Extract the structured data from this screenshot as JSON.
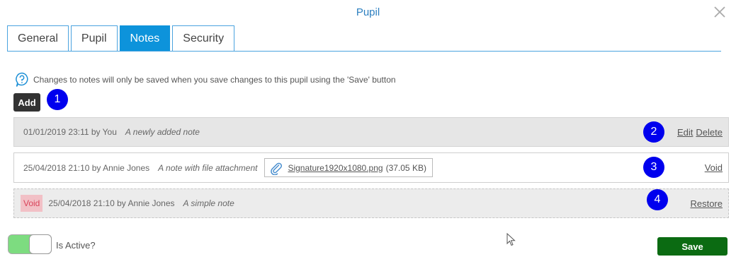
{
  "dialog": {
    "title": "Pupil"
  },
  "tabs": [
    {
      "label": "General"
    },
    {
      "label": "Pupil"
    },
    {
      "label": "Notes"
    },
    {
      "label": "Security"
    }
  ],
  "active_tab": "Notes",
  "info_text": "Changes to notes will only be saved when you save changes to this pupil using the 'Save' button",
  "add_label": "Add",
  "callouts": [
    "1",
    "2",
    "3",
    "4"
  ],
  "notes": [
    {
      "meta": "01/01/2019 23:11 by You",
      "text": "A newly added note",
      "actions": [
        "Edit",
        "Delete"
      ]
    },
    {
      "meta": "25/04/2018 21:10 by Annie Jones",
      "text": "A note with file attachment",
      "attachment": {
        "name": "Signature1920x1080.png",
        "size": "(37.05 KB)"
      },
      "actions": [
        "Void"
      ]
    },
    {
      "status": "Void",
      "meta": "25/04/2018 21:10 by Annie Jones",
      "text": "A simple note",
      "actions": [
        "Restore"
      ]
    }
  ],
  "active_toggle": {
    "label": "Is Active?",
    "on": true
  },
  "save_label": "Save",
  "colors": {
    "accent": "#0d93db",
    "title": "#2c7fc0",
    "save": "#0b6b12",
    "toggle_on": "#7ddc80",
    "void_bg": "#f2c0c6",
    "void_text": "#d9435a",
    "callout": "#0000ee"
  }
}
